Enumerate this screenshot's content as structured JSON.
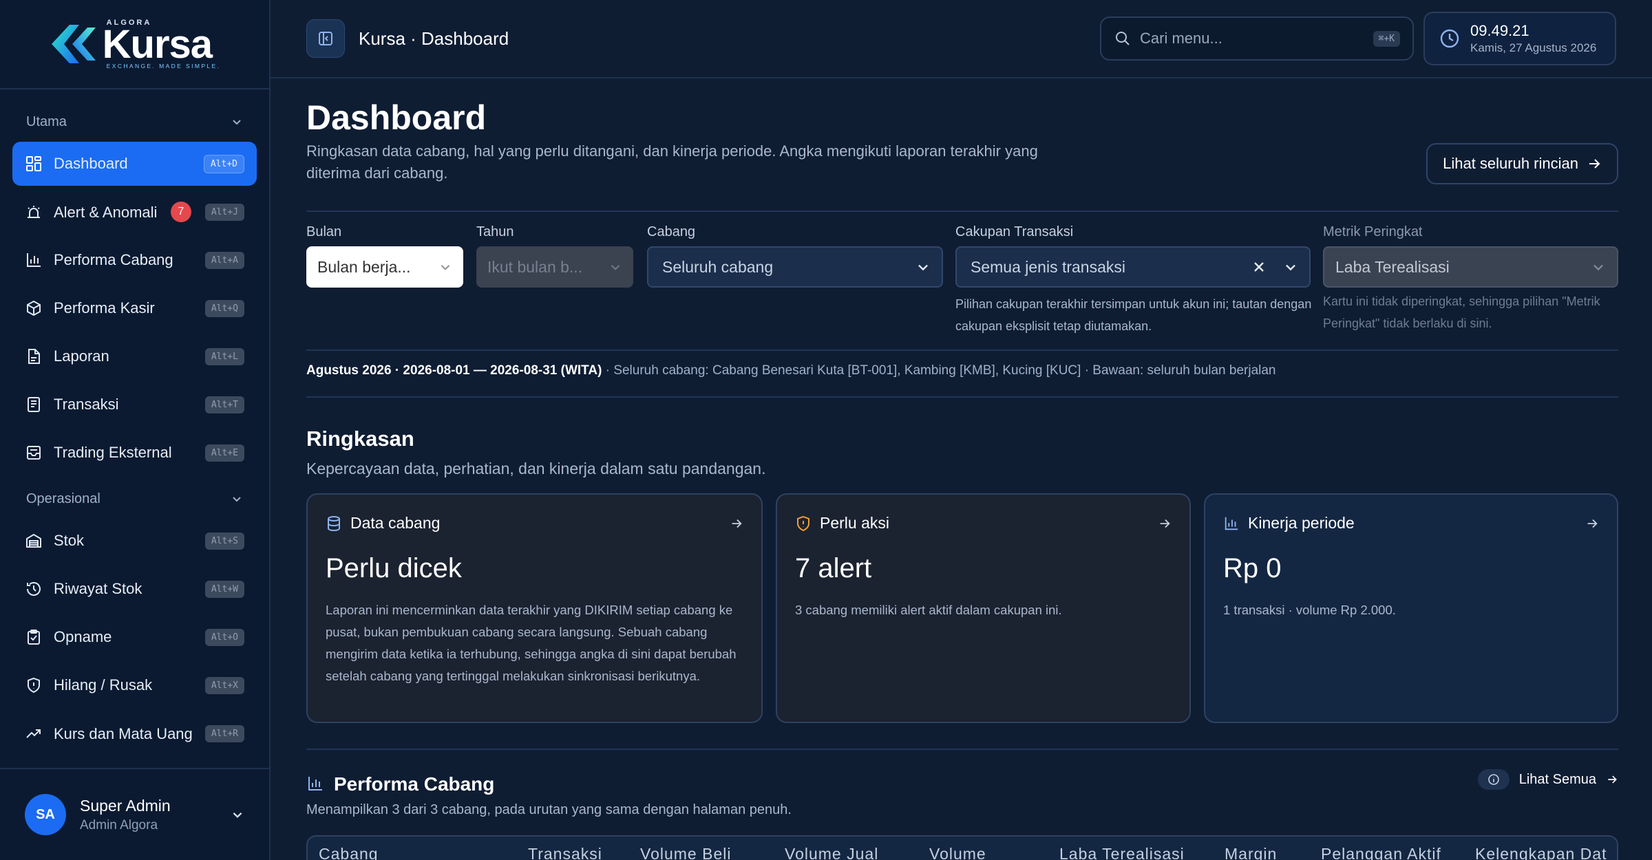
{
  "brand": {
    "top": "ALGORA",
    "word": "Kursa",
    "tagline": "EXCHANGE. MADE SIMPLE."
  },
  "sidebar": {
    "sections": [
      {
        "title": "Utama",
        "items": [
          {
            "label": "Dashboard",
            "kbd": "Alt+D",
            "icon": "grid-icon",
            "active": true
          },
          {
            "label": "Alert & Anomali",
            "kbd": "Alt+J",
            "icon": "alarm-icon",
            "badge": "7"
          },
          {
            "label": "Performa Cabang",
            "kbd": "Alt+A",
            "icon": "bar-chart-icon"
          },
          {
            "label": "Performa Kasir",
            "kbd": "Alt+Q",
            "icon": "box-icon"
          },
          {
            "label": "Laporan",
            "kbd": "Alt+L",
            "icon": "document-icon"
          },
          {
            "label": "Transaksi",
            "kbd": "Alt+T",
            "icon": "receipt-icon"
          },
          {
            "label": "Trading Eksternal",
            "kbd": "Alt+E",
            "icon": "inbox-icon"
          }
        ]
      },
      {
        "title": "Operasional",
        "items": [
          {
            "label": "Stok",
            "kbd": "Alt+S",
            "icon": "warehouse-icon"
          },
          {
            "label": "Riwayat Stok",
            "kbd": "Alt+W",
            "icon": "history-icon"
          },
          {
            "label": "Opname",
            "kbd": "Alt+O",
            "icon": "clipboard-icon"
          },
          {
            "label": "Hilang / Rusak",
            "kbd": "Alt+X",
            "icon": "shield-icon"
          },
          {
            "label": "Kurs dan Mata Uang",
            "kbd": "Alt+R",
            "icon": "trend-icon"
          }
        ]
      }
    ]
  },
  "user": {
    "initials": "SA",
    "name": "Super Admin",
    "role": "Admin Algora"
  },
  "topbar": {
    "breadcrumb": "Kursa · Dashboard",
    "search_placeholder": "Cari menu...",
    "search_kbd": "⌘+K",
    "time": "09.49.21",
    "date": "Kamis, 27 Agustus 2026"
  },
  "header": {
    "title": "Dashboard",
    "description": "Ringkasan data cabang, hal yang perlu ditangani, dan kinerja periode. Angka mengikuti laporan terakhir yang diterima dari cabang.",
    "all_button": "Lihat seluruh rincian"
  },
  "filters": {
    "bulan": {
      "label": "Bulan",
      "value": "Bulan berja..."
    },
    "tahun": {
      "label": "Tahun",
      "value": "Ikut bulan b..."
    },
    "cabang": {
      "label": "Cabang",
      "value": "Seluruh cabang"
    },
    "cakupan": {
      "label": "Cakupan Transaksi",
      "value": "Semua jenis transaksi",
      "hint": "Pilihan cakupan terakhir tersimpan untuk akun ini; tautan dengan cakupan eksplisit tetap diutamakan."
    },
    "metrik": {
      "label": "Metrik Peringkat",
      "value": "Laba Terealisasi",
      "hint": "Kartu ini tidak diperingkat, sehingga pilihan \"Metrik Peringkat\" tidak berlaku di sini."
    }
  },
  "info_line": {
    "period": "Agustus 2026 · 2026-08-01 — 2026-08-31 (WITA)",
    "rest": " · Seluruh cabang: Cabang Benesari Kuta [BT-001], Kambing [KMB], Kucing [KUC] · Bawaan: seluruh bulan berjalan"
  },
  "summary": {
    "title": "Ringkasan",
    "subtitle": "Kepercayaan data, perhatian, dan kinerja dalam satu pandangan.",
    "cards": [
      {
        "title": "Data cabang",
        "value": "Perlu dicek",
        "body": "Laporan ini mencerminkan data terakhir yang DIKIRIM setiap cabang ke pusat, bukan pembukuan cabang secara langsung. Sebuah cabang mengirim data ketika ia terhubung, sehingga angka di sini dapat berubah setelah cabang yang tertinggal melakukan sinkronisasi berikutnya."
      },
      {
        "title": "Perlu aksi",
        "value": "7 alert",
        "body": "3 cabang memiliki alert aktif dalam cakupan ini."
      },
      {
        "title": "Kinerja periode",
        "value": "Rp 0",
        "body": "1 transaksi · volume Rp 2.000."
      }
    ]
  },
  "performance": {
    "title": "Performa Cabang",
    "subtitle": "Menampilkan 3 dari 3 cabang, pada urutan yang sama dengan halaman penuh.",
    "link": "Lihat Semua",
    "columns": [
      "Cabang",
      "Transaksi",
      "Volume Beli",
      "Volume Jual",
      "Volume",
      "Laba Terealisasi",
      "Margin",
      "Pelanggan Aktif",
      "Kelengkapan Dat"
    ]
  },
  "colors": {
    "accent": "#1b6cf2",
    "badge": "#e5484d",
    "warning": "#f0a030",
    "bg": "#0f1d33"
  }
}
